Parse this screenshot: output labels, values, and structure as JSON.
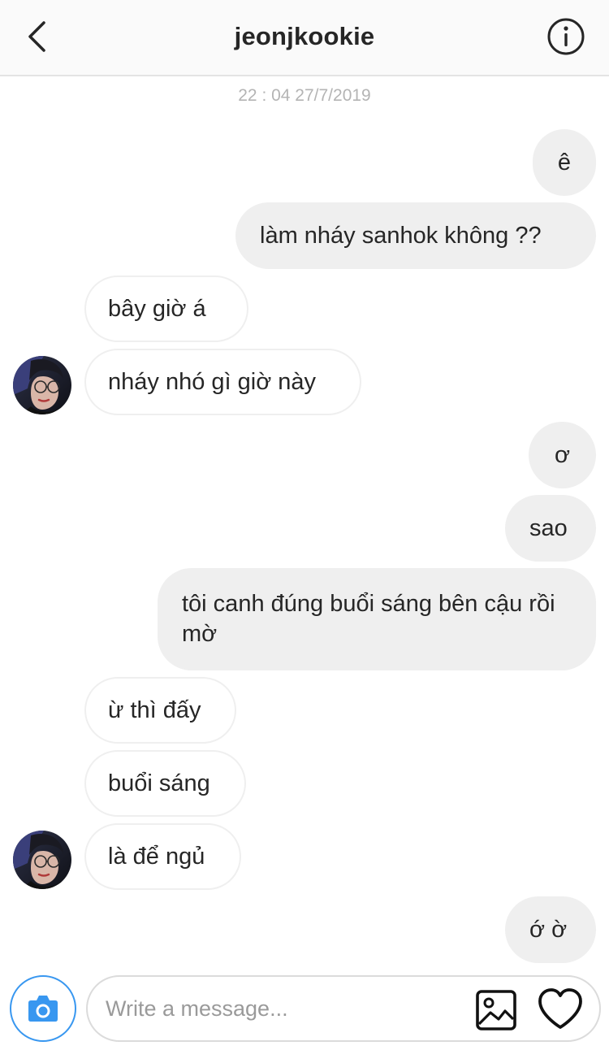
{
  "header": {
    "title": "jeonjkookie",
    "back_icon": "chevron-left-icon",
    "info_icon": "info-icon"
  },
  "conversation": {
    "timestamp": "22 : 04 27/7/2019",
    "messages": [
      {
        "side": "outgoing",
        "text": "ê"
      },
      {
        "side": "outgoing",
        "text": "làm nháy sanhok không ??"
      },
      {
        "side": "incoming",
        "text": "bây giờ á"
      },
      {
        "side": "incoming",
        "text": "nháy nhó gì giờ này"
      },
      {
        "side": "outgoing",
        "text": "ơ"
      },
      {
        "side": "outgoing",
        "text": "sao"
      },
      {
        "side": "outgoing",
        "text": "tôi canh đúng buổi sáng bên cậu rồi mờ"
      },
      {
        "side": "incoming",
        "text": "ừ thì đấy"
      },
      {
        "side": "incoming",
        "text": "buổi sáng"
      },
      {
        "side": "incoming",
        "text": "là để ngủ"
      },
      {
        "side": "outgoing",
        "text": "ớ ờ"
      }
    ]
  },
  "composer": {
    "placeholder": "Write a message...",
    "value": "",
    "camera_icon": "camera-icon",
    "gallery_icon": "gallery-icon",
    "like_icon": "heart-icon"
  },
  "colors": {
    "outgoing_bubble": "#efefef",
    "incoming_border": "#efefef",
    "text": "#262626",
    "timestamp": "#b4b4b4",
    "accent": "#3897f0"
  }
}
